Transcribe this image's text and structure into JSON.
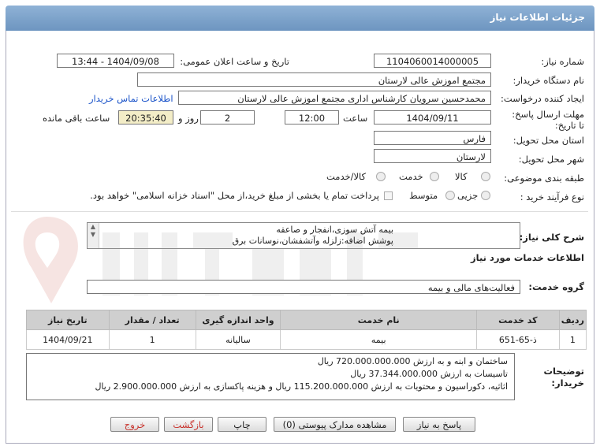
{
  "header": {
    "title": "جزئیات اطلاعات نیاز"
  },
  "form": {
    "need_number_label": "شماره نیاز:",
    "need_number": "1104060014000005",
    "announce_label": "تاریخ و ساعت اعلان عمومی:",
    "announce_value": "1404/09/08 - 13:44",
    "buyer_org_label": "نام دستگاه خریدار:",
    "buyer_org": "مجتمع اموزش عالی لارستان",
    "creator_label": "ایجاد کننده درخواست:",
    "creator": "محمدحسین سرویان کارشناس اداری مجتمع اموزش عالی لارستان",
    "contact_link": "اطلاعات تماس خریدار",
    "deadline_label": "مهلت ارسال پاسخ: تا تاریخ:",
    "deadline_date": "1404/09/11",
    "time_label": "ساعت",
    "deadline_time": "12:00",
    "days_value": "2",
    "days_label": "روز و",
    "remaining_time": "20:35:40",
    "remaining_label": "ساعت باقی مانده",
    "province_label": "استان محل تحویل:",
    "province": "فارس",
    "city_label": "شهر محل تحویل:",
    "city": "لارستان",
    "category_label": "طبقه بندی موضوعی:",
    "category_options": [
      "کالا",
      "خدمت",
      "کالا/خدمت"
    ],
    "process_label": "نوع فرآیند خرید :",
    "process_options": [
      "جزیی",
      "متوسط"
    ],
    "payment_note": "پرداخت تمام یا بخشی از مبلغ خرید،از محل \"اسناد خزانه اسلامی\" خواهد بود."
  },
  "summary": {
    "label": "شرح کلی نیاز:",
    "line1": "بیمه آتش سوزی،انفجار و صاعقه",
    "line2": "پوشش اضافه:زلزله وآتشفشان،نوسانات برق"
  },
  "services": {
    "section_title": "اطلاعات خدمات مورد نیاز",
    "group_label": "گروه خدمت:",
    "group_value": "فعالیت‌های مالی و بیمه",
    "columns": [
      "ردیف",
      "کد خدمت",
      "نام خدمت",
      "واحد اندازه گیری",
      "تعداد / مقدار",
      "تاریخ نیاز"
    ],
    "rows": [
      [
        "1",
        "ذ-65-651",
        "بیمه",
        "سالیانه",
        "1",
        "1404/09/21"
      ]
    ]
  },
  "notes": {
    "label": "توضیحات خریدار:",
    "line1": "ساختمان و ابنه و  به ارزش 720.000.000.000 ریال",
    "line2": "تاسیسات به ارزش 37.344.000.000 ریال",
    "line3": "اثاثیه، دکوراسیون و محتویات به ارزش 115.200.000.000 ریال و هزینه پاکسازی به ارزش 2.900.000.000 ریال"
  },
  "buttons": {
    "reply": "پاسخ به نیاز",
    "attachments": "مشاهده مدارک پیوستی (0)",
    "print": "چاپ",
    "back": "بازگشت",
    "exit": "خروج"
  },
  "colors": {
    "title_bar": "#7aa0c9",
    "link": "#1a53c9",
    "highlight": "#f3edc7",
    "button_text_red": "#c8302a"
  }
}
